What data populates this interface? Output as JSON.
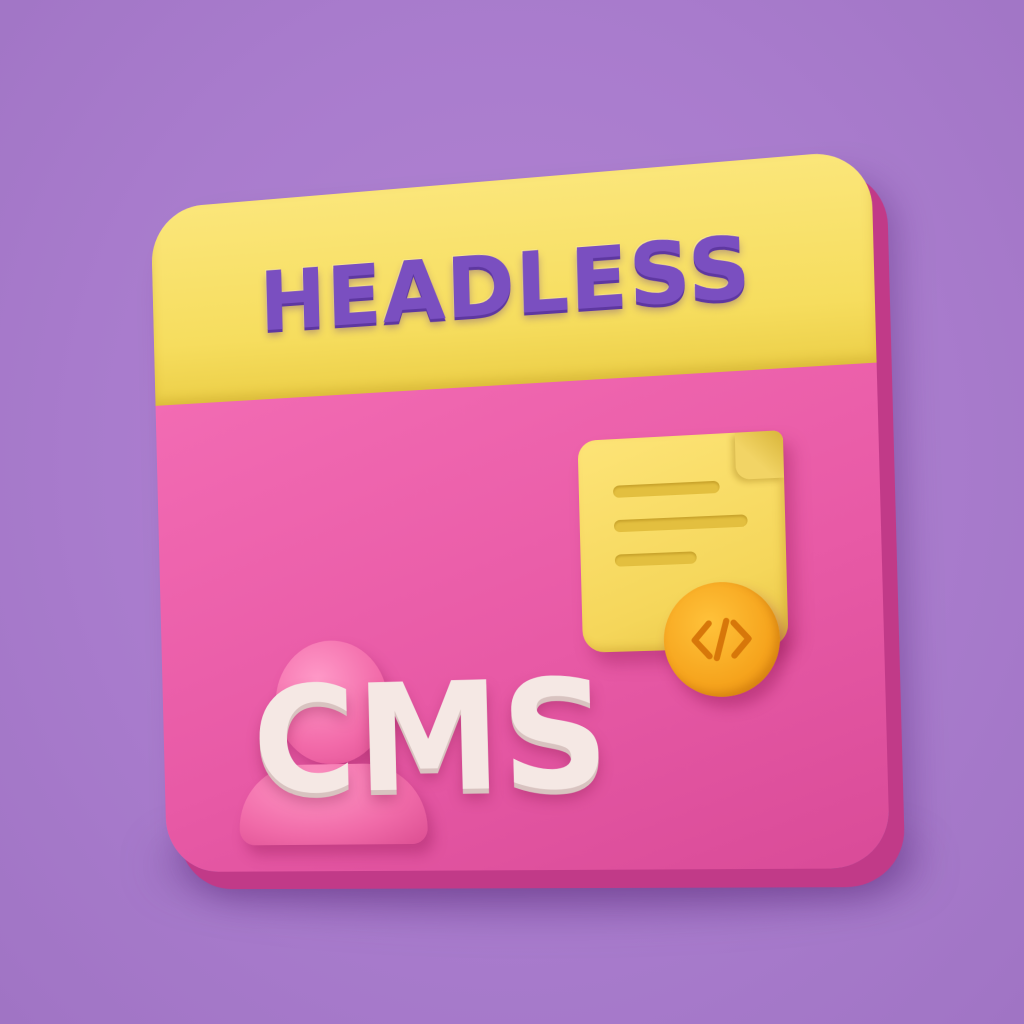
{
  "tile": {
    "top_label": "HEADLESS",
    "bottom_label": "CMS"
  },
  "icons": {
    "person": "user-icon",
    "document": "document-icon",
    "code": "code-icon"
  },
  "colors": {
    "background": "#a97ccd",
    "top_band": "#f6dd5e",
    "bottom_band": "#e85aa6",
    "top_text": "#7a4fc0",
    "bottom_text": "#f5e8e4",
    "badge": "#f6a41d"
  }
}
